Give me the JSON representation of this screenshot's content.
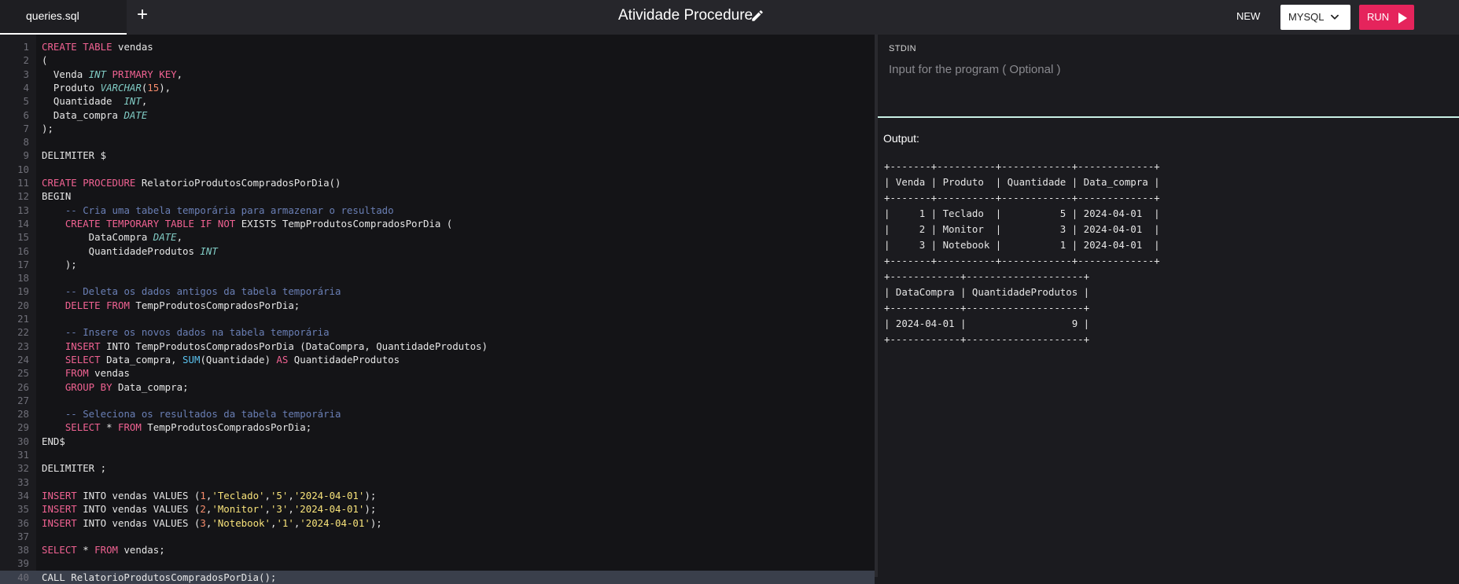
{
  "header": {
    "tab_label": "queries.sql",
    "add_tab_symbol": "+",
    "title": "Atividade Procedure",
    "new_label": "NEW",
    "language_label": "MYSQL",
    "run_label": "RUN"
  },
  "editor": {
    "active_line": 40,
    "lines": [
      "CREATE TABLE vendas",
      "(",
      "  Venda INT PRIMARY KEY,",
      "  Produto VARCHAR(15),",
      "  Quantidade  INT,",
      "  Data_compra DATE",
      ");",
      "",
      "DELIMITER $",
      "",
      "CREATE PROCEDURE RelatorioProdutosCompradosPorDia()",
      "BEGIN",
      "    -- Cria uma tabela temporária para armazenar o resultado",
      "    CREATE TEMPORARY TABLE IF NOT EXISTS TempProdutosCompradosPorDia (",
      "        DataCompra DATE,",
      "        QuantidadeProdutos INT",
      "    );",
      "",
      "    -- Deleta os dados antigos da tabela temporária",
      "    DELETE FROM TempProdutosCompradosPorDia;",
      "",
      "    -- Insere os novos dados na tabela temporária",
      "    INSERT INTO TempProdutosCompradosPorDia (DataCompra, QuantidadeProdutos)",
      "    SELECT Data_compra, SUM(Quantidade) AS QuantidadeProdutos",
      "    FROM vendas",
      "    GROUP BY Data_compra;",
      "",
      "    -- Seleciona os resultados da tabela temporária",
      "    SELECT * FROM TempProdutosCompradosPorDia;",
      "END$",
      "",
      "DELIMITER ;",
      "",
      "INSERT INTO vendas VALUES (1,'Teclado','5','2024-04-01');",
      "INSERT INTO vendas VALUES (2,'Monitor','3','2024-04-01');",
      "INSERT INTO vendas VALUES (3,'Notebook','1','2024-04-01');",
      "",
      "SELECT * FROM vendas;",
      "",
      "CALL RelatorioProdutosCompradosPorDia();"
    ]
  },
  "stdin": {
    "label": "STDIN",
    "placeholder": "Input for the program ( Optional )"
  },
  "output": {
    "label": "Output:",
    "text": "+-------+----------+------------+-------------+\n| Venda | Produto  | Quantidade | Data_compra |\n+-------+----------+------------+-------------+\n|     1 | Teclado  |          5 | 2024-04-01  |\n|     2 | Monitor  |          3 | 2024-04-01  |\n|     3 | Notebook |          1 | 2024-04-01  |\n+-------+----------+------------+-------------+\n+------------+--------------------+\n| DataCompra | QuantidadeProdutos |\n+------------+--------------------+\n| 2024-04-01 |                  9 |\n+------------+--------------------+"
  },
  "colors": {
    "accent_run": "#e5245c",
    "divider": "#c9f0e4",
    "keyword": "#f06292",
    "type": "#80cbc4",
    "string": "#f7e27a",
    "comment": "#6a7fb5"
  },
  "icons": {
    "title_edit": "pencil-icon",
    "language_dropdown": "chevron-down-icon",
    "run": "play-icon"
  }
}
